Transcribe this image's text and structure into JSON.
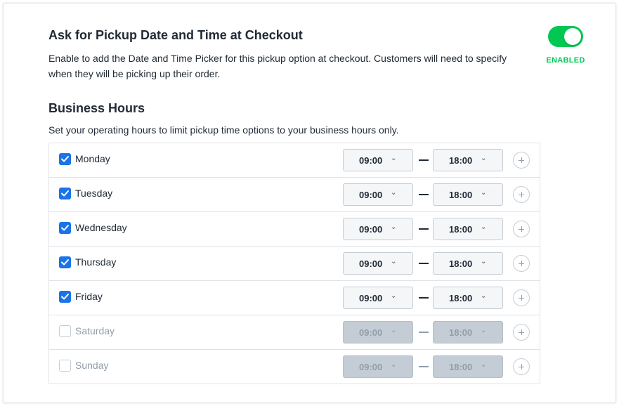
{
  "pickup_setting": {
    "title": "Ask for Pickup Date and Time at Checkout",
    "description": "Enable to add the Date and Time Picker for this pickup option at checkout. Customers will need to specify when they will be picking up their order.",
    "toggle_status": "ENABLED",
    "enabled": true,
    "accent_color": "#00c853"
  },
  "business_hours": {
    "title": "Business Hours",
    "description": "Set your operating hours to limit pickup time options to your business hours only.",
    "days": [
      {
        "name": "Monday",
        "enabled": true,
        "open": "09:00",
        "close": "18:00"
      },
      {
        "name": "Tuesday",
        "enabled": true,
        "open": "09:00",
        "close": "18:00"
      },
      {
        "name": "Wednesday",
        "enabled": true,
        "open": "09:00",
        "close": "18:00"
      },
      {
        "name": "Thursday",
        "enabled": true,
        "open": "09:00",
        "close": "18:00"
      },
      {
        "name": "Friday",
        "enabled": true,
        "open": "09:00",
        "close": "18:00"
      },
      {
        "name": "Saturday",
        "enabled": false,
        "open": "09:00",
        "close": "18:00"
      },
      {
        "name": "Sunday",
        "enabled": false,
        "open": "09:00",
        "close": "18:00"
      }
    ],
    "checkbox_color": "#1a73e8",
    "separator": "—",
    "dropdown_icon": "chevron-down-icon",
    "add_icon": "plus-circle-icon"
  }
}
